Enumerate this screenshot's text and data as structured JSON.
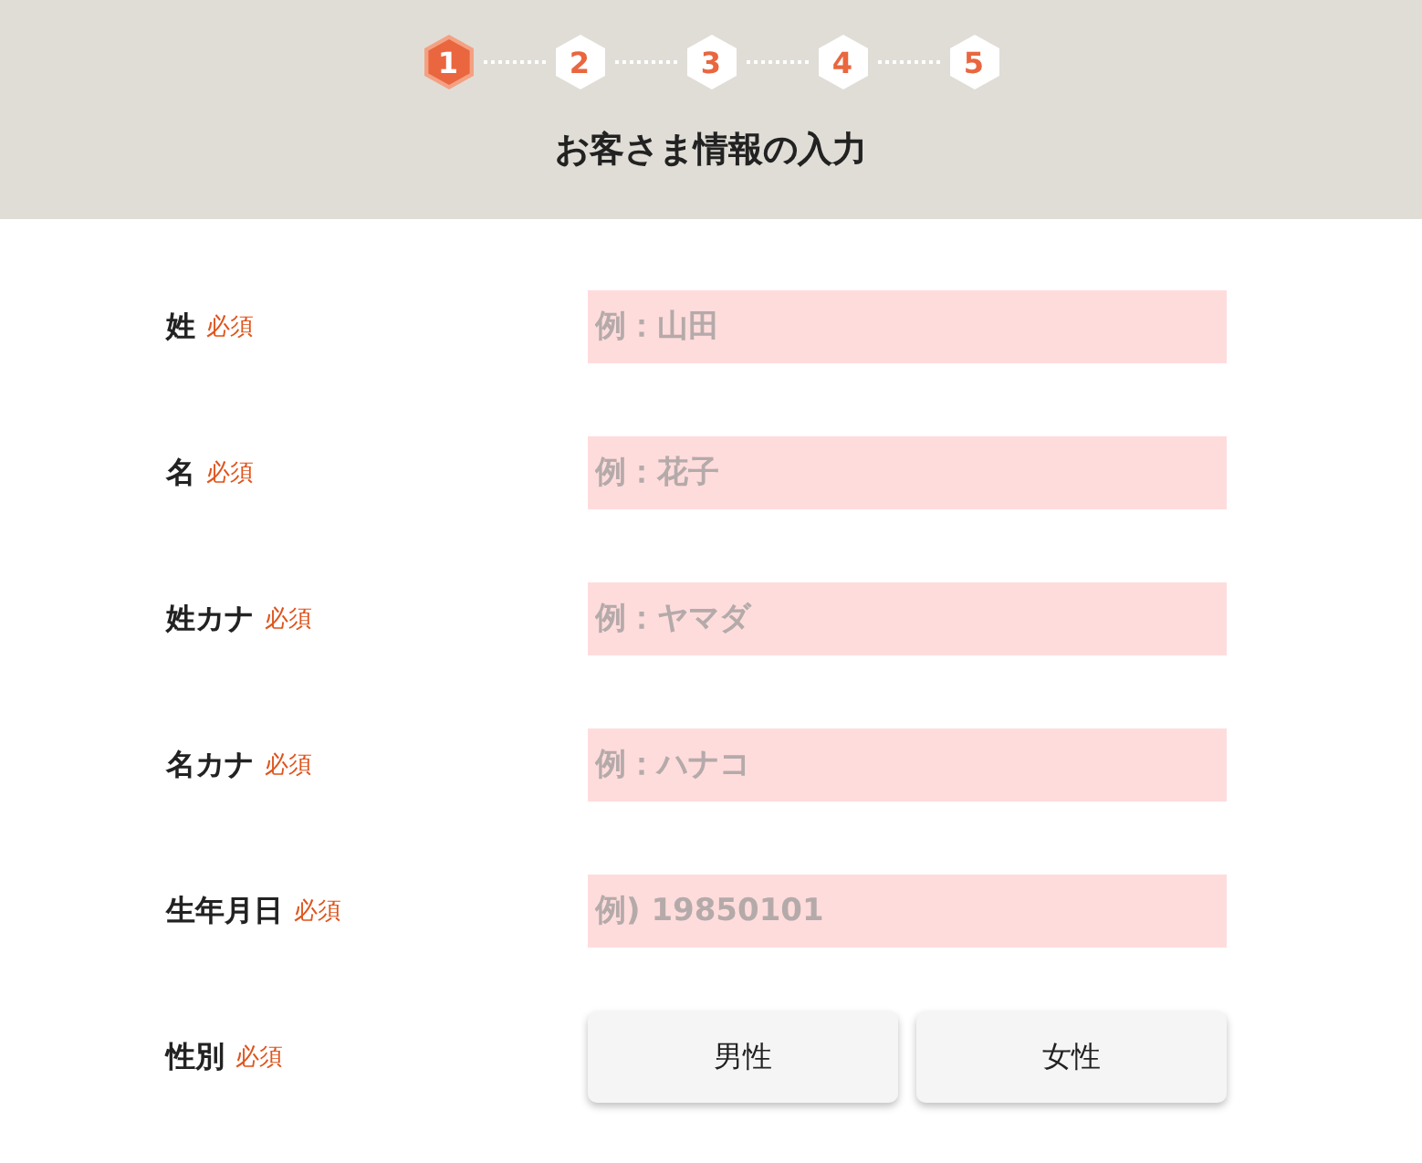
{
  "steps": [
    {
      "label": "1",
      "selected": true
    },
    {
      "label": "2",
      "selected": false
    },
    {
      "label": "3",
      "selected": false
    },
    {
      "label": "4",
      "selected": false
    },
    {
      "label": "5",
      "selected": false
    }
  ],
  "title": "お客さま情報の入力",
  "fields": [
    {
      "kind": "text",
      "label": "姓",
      "required": "必須",
      "placeholder": "例：山田"
    },
    {
      "kind": "text",
      "label": "名",
      "required": "必須",
      "placeholder": "例：花子"
    },
    {
      "kind": "text",
      "label": "姓カナ",
      "required": "必須",
      "placeholder": "例：ヤマダ"
    },
    {
      "kind": "text",
      "label": "名カナ",
      "required": "必須",
      "placeholder": "例：ハナコ"
    },
    {
      "kind": "text",
      "label": "生年月日",
      "required": "必須",
      "placeholder": "例) 19850101"
    },
    {
      "kind": "choice",
      "label": "性別",
      "required": "必須",
      "options": [
        "男性",
        "女性"
      ]
    }
  ]
}
